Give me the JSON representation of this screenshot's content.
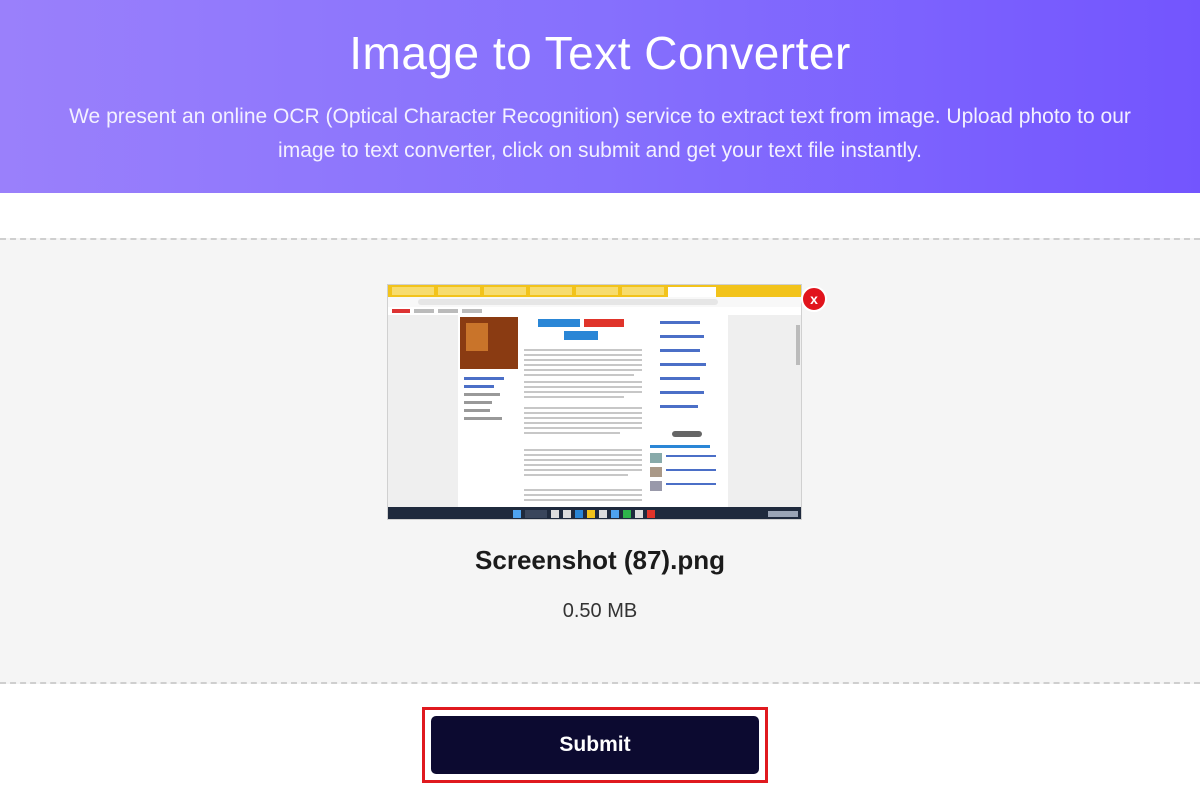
{
  "hero": {
    "title": "Image to Text Converter",
    "description": "We present an online OCR (Optical Character Recognition) service to extract text from image. Upload photo to our image to text converter, click on submit and get your text file instantly."
  },
  "upload": {
    "remove_label": "x",
    "file_name": "Screenshot (87).png",
    "file_size": "0.50 MB"
  },
  "actions": {
    "submit_label": "Submit"
  },
  "colors": {
    "hero_gradient_start": "#9a80fb",
    "hero_gradient_end": "#7355fe",
    "submit_bg": "#0c0a30",
    "highlight": "#e0191f",
    "remove_bg": "#e1141c"
  }
}
